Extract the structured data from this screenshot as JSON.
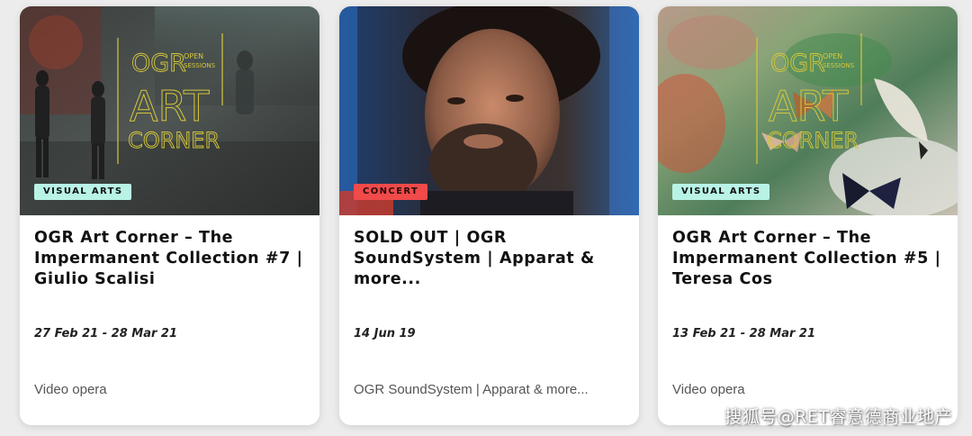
{
  "cards": [
    {
      "badge": "VISUAL ARTS",
      "title": "OGR Art Corner – The Impermanent Collection #7 | Giulio Scalisi",
      "date": "27 Feb 21 - 28 Mar 21",
      "subtitle": "Video opera",
      "image_overlay": {
        "top": "OGR",
        "small1": "OPEN",
        "small2": "SESSIONS",
        "mid": "ART",
        "bottom": "CORNER"
      }
    },
    {
      "badge": "CONCERT",
      "title": "SOLD OUT | OGR SoundSystem | Apparat & more...",
      "date": "14 Jun 19",
      "subtitle": "OGR SoundSystem | Apparat & more..."
    },
    {
      "badge": "VISUAL ARTS",
      "title": "OGR Art Corner – The Impermanent Collection #5 | Teresa Cos",
      "date": "13 Feb 21 - 28 Mar 21",
      "subtitle": "Video opera",
      "image_overlay": {
        "top": "OGR",
        "small1": "OPEN",
        "small2": "SESSIONS",
        "mid": "ART",
        "bottom": "CORNER"
      }
    }
  ],
  "watermark": "搜狐号@RET睿意德商业地产",
  "colors": {
    "visual_arts_badge": "#b8f3e6",
    "concert_badge": "#f04a4a",
    "logo_yellow": "#d6c73a"
  }
}
